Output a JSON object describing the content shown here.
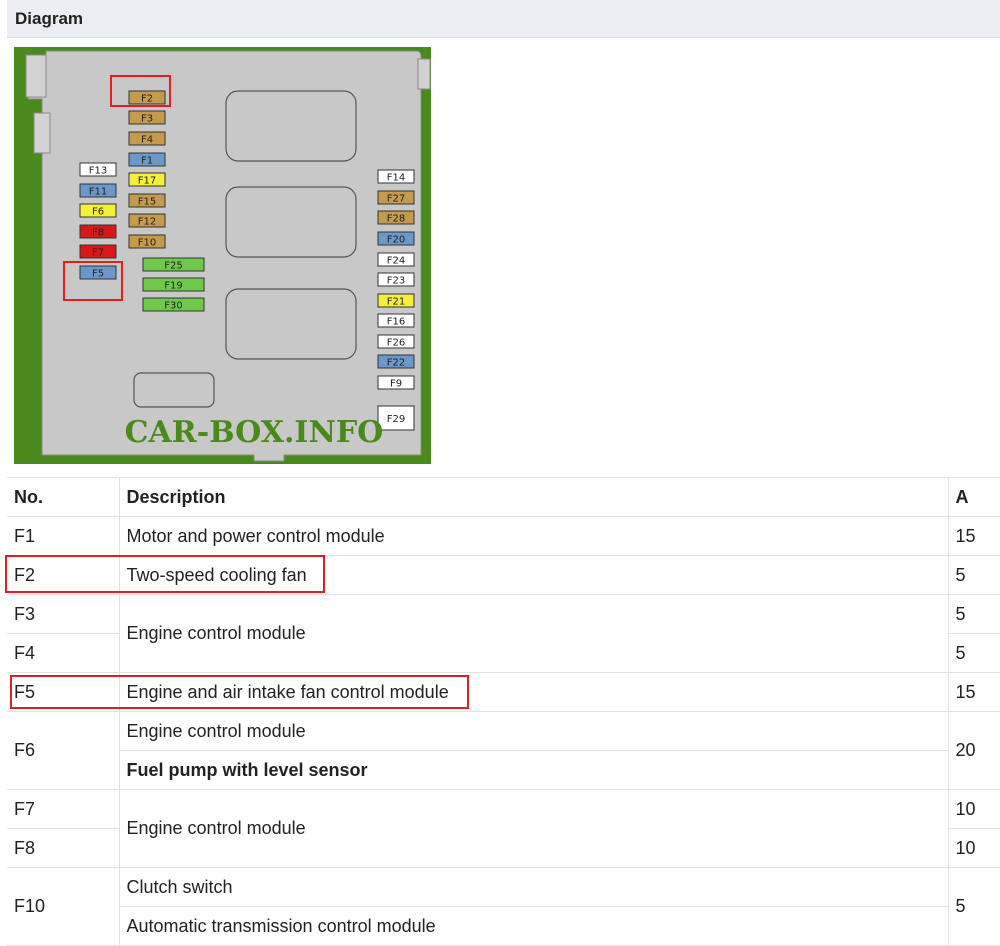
{
  "section": {
    "title": "Diagram"
  },
  "diagram": {
    "watermark": "CAR-BOX.INFO",
    "colors": {
      "green": "#4a8a1c",
      "box": "#c8c8c8",
      "tan": "#c49a4c",
      "blue": "#6a98c8",
      "white": "#ffffff",
      "yellow": "#f4f03a",
      "red": "#d81818",
      "lime": "#70c84a",
      "highlight": "#e02020"
    },
    "fuses": [
      {
        "label": "F2",
        "color": "tan"
      },
      {
        "label": "F3",
        "color": "tan"
      },
      {
        "label": "F4",
        "color": "tan"
      },
      {
        "label": "F1",
        "color": "blue"
      },
      {
        "label": "F17",
        "color": "yellow"
      },
      {
        "label": "F15",
        "color": "tan"
      },
      {
        "label": "F12",
        "color": "tan"
      },
      {
        "label": "F10",
        "color": "tan"
      },
      {
        "label": "F13",
        "color": "white"
      },
      {
        "label": "F11",
        "color": "blue"
      },
      {
        "label": "F6",
        "color": "yellow"
      },
      {
        "label": "F8",
        "color": "red"
      },
      {
        "label": "F7",
        "color": "red"
      },
      {
        "label": "F5",
        "color": "blue"
      },
      {
        "label": "F25",
        "color": "lime"
      },
      {
        "label": "F19",
        "color": "lime"
      },
      {
        "label": "F30",
        "color": "lime"
      },
      {
        "label": "F14",
        "color": "white"
      },
      {
        "label": "F27",
        "color": "tan"
      },
      {
        "label": "F28",
        "color": "tan"
      },
      {
        "label": "F20",
        "color": "blue"
      },
      {
        "label": "F24",
        "color": "white"
      },
      {
        "label": "F23",
        "color": "white"
      },
      {
        "label": "F21",
        "color": "yellow"
      },
      {
        "label": "F16",
        "color": "white"
      },
      {
        "label": "F26",
        "color": "white"
      },
      {
        "label": "F22",
        "color": "blue"
      },
      {
        "label": "F9",
        "color": "white"
      },
      {
        "label": "F29",
        "color": "white"
      }
    ]
  },
  "table": {
    "headers": {
      "no": "No.",
      "description": "Description",
      "amps": "A"
    },
    "rows": {
      "f1": {
        "no": "F1",
        "desc": "Motor and power control module",
        "amps": "15"
      },
      "f2": {
        "no": "F2",
        "desc": "Two-speed cooling fan",
        "amps": "5"
      },
      "f3": {
        "no": "F3",
        "desc": "Engine control module",
        "amps": "5"
      },
      "f4": {
        "no": "F4",
        "amps": "5"
      },
      "f5": {
        "no": "F5",
        "desc": "Engine and air intake fan control module",
        "amps": "15"
      },
      "f6": {
        "no": "F6",
        "desc1": "Engine control module",
        "desc2": "Fuel pump with level sensor",
        "amps": "20"
      },
      "f7": {
        "no": "F7",
        "desc": "Engine control module",
        "amps": "10"
      },
      "f8": {
        "no": "F8",
        "amps": "10"
      },
      "f10": {
        "no": "F10",
        "desc1": "Clutch switch",
        "desc2": "Automatic transmission control module",
        "amps": "5"
      }
    }
  }
}
